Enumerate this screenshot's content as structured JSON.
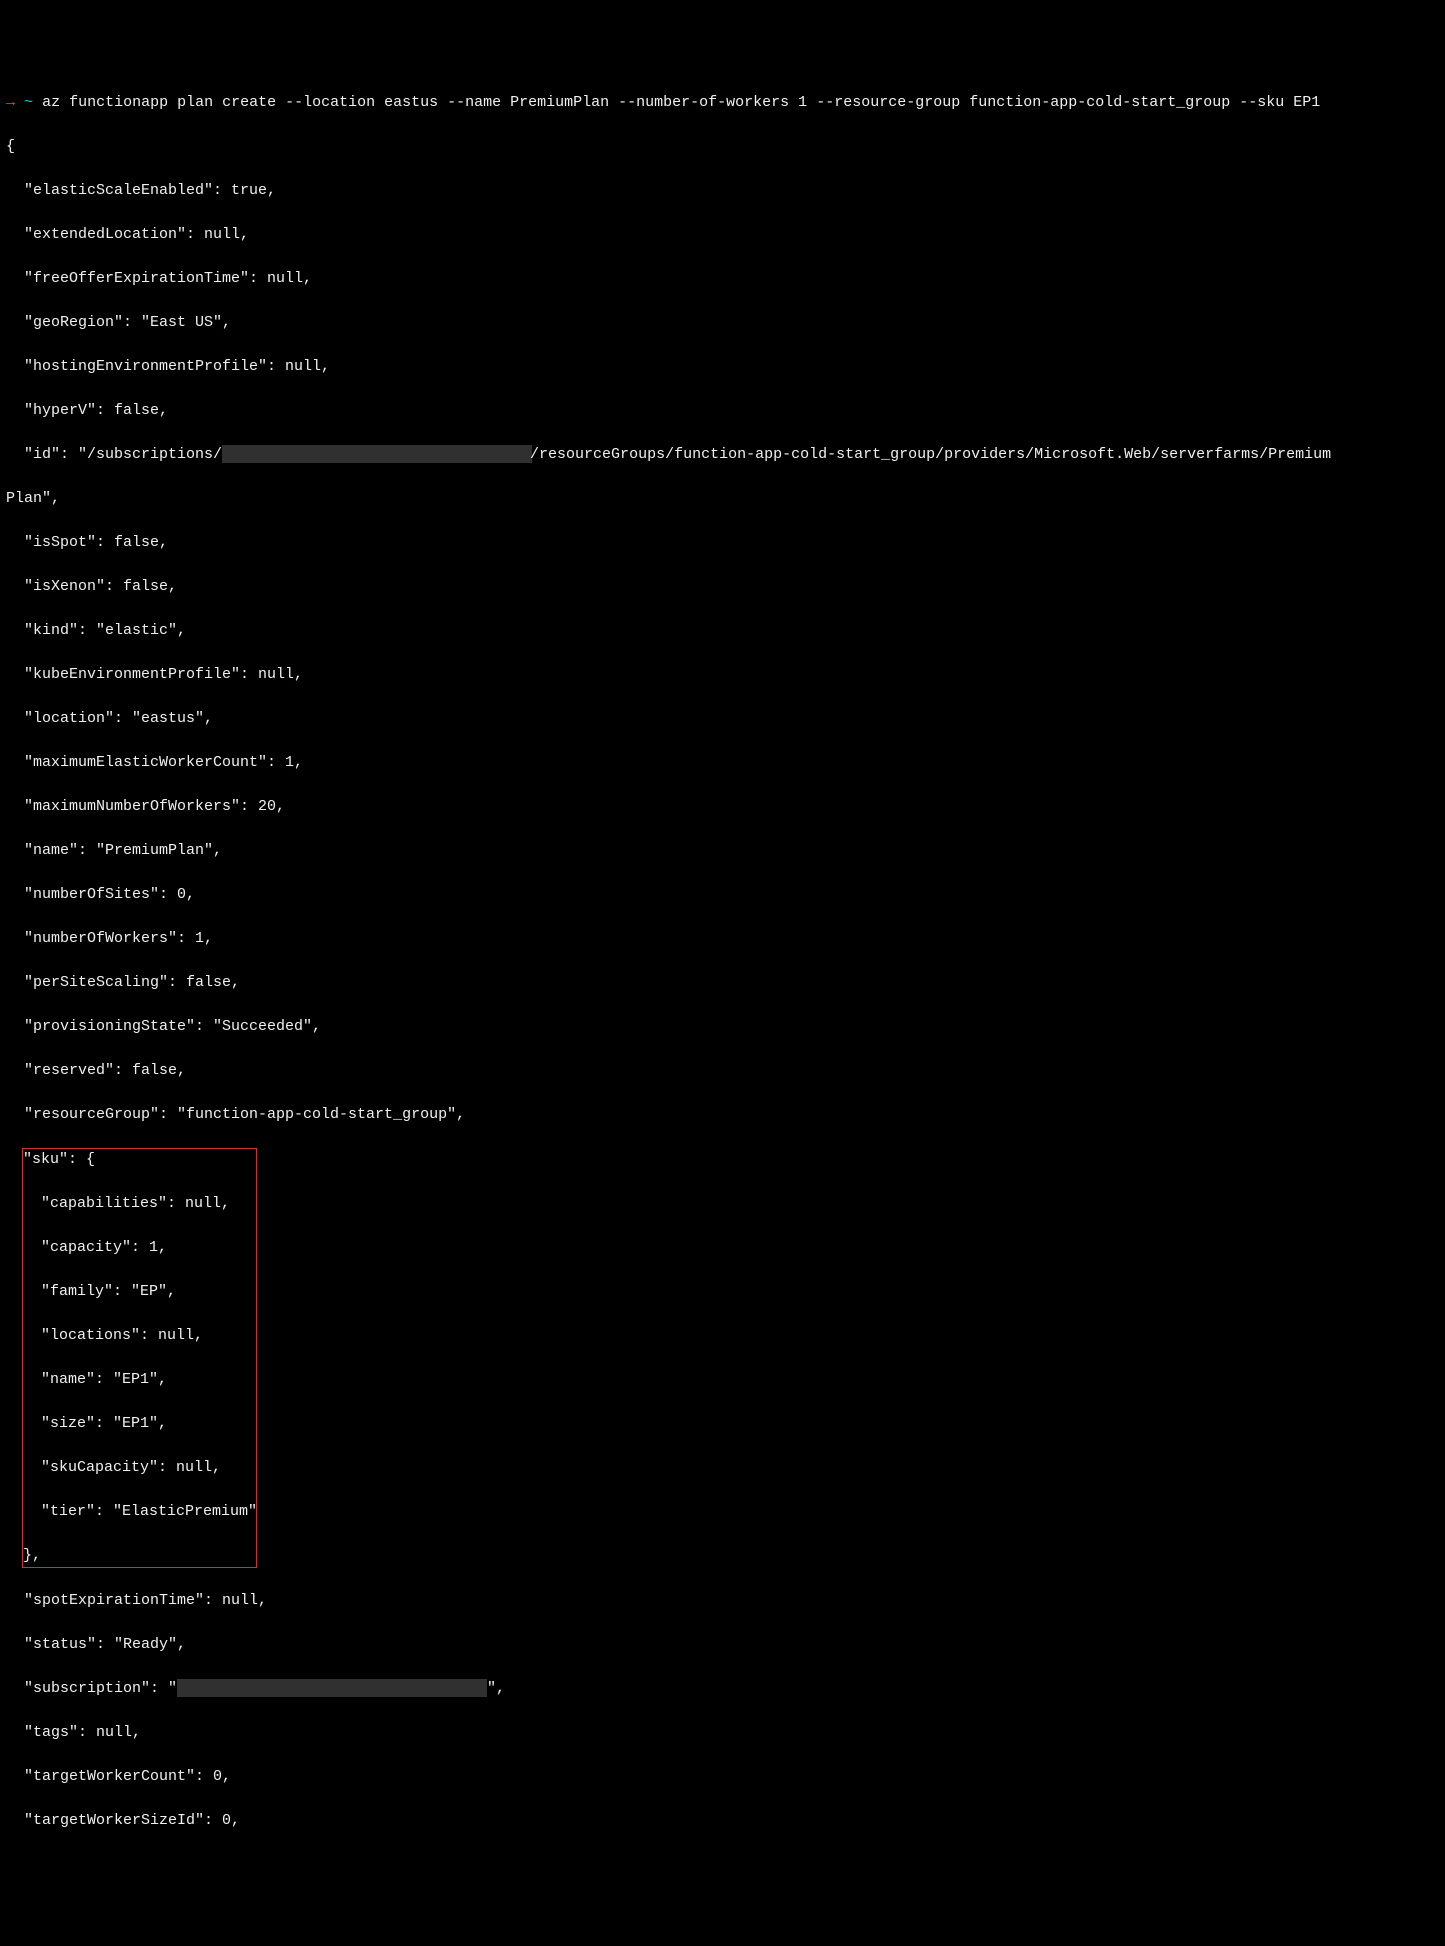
{
  "prompt": {
    "arrow": "→",
    "tilde": "~",
    "command": "az functionapp plan create --location eastus --name PremiumPlan --number-of-workers 1 --resource-group function-app-cold-start_group --sku EP1"
  },
  "json_output": {
    "open_brace": "{",
    "elasticScaleEnabled": "  \"elasticScaleEnabled\": true,",
    "extendedLocation": "  \"extendedLocation\": null,",
    "freeOfferExpirationTime": "  \"freeOfferExpirationTime\": null,",
    "geoRegion": "  \"geoRegion\": \"East US\",",
    "hostingEnvironmentProfile": "  \"hostingEnvironmentProfile\": null,",
    "hyperV": "  \"hyperV\": false,",
    "id_prefix": "  \"id\": \"/subscriptions/",
    "id_suffix": "/resourceGroups/function-app-cold-start_group/providers/Microsoft.Web/serverfarms/Premium",
    "plan_wrap": "Plan\",",
    "isSpot": "  \"isSpot\": false,",
    "isXenon": "  \"isXenon\": false,",
    "kind": "  \"kind\": \"elastic\",",
    "kubeEnvironmentProfile": "  \"kubeEnvironmentProfile\": null,",
    "location": "  \"location\": \"eastus\",",
    "maximumElasticWorkerCount": "  \"maximumElasticWorkerCount\": 1,",
    "maximumNumberOfWorkers": "  \"maximumNumberOfWorkers\": 20,",
    "name": "  \"name\": \"PremiumPlan\",",
    "numberOfSites": "  \"numberOfSites\": 0,",
    "numberOfWorkers": "  \"numberOfWorkers\": 1,",
    "perSiteScaling": "  \"perSiteScaling\": false,",
    "provisioningState": "  \"provisioningState\": \"Succeeded\",",
    "reserved": "  \"reserved\": false,",
    "resourceGroup": "  \"resourceGroup\": \"function-app-cold-start_group\",",
    "sku_open": "\"sku\": {",
    "sku_capabilities": "  \"capabilities\": null,",
    "sku_capacity": "  \"capacity\": 1,",
    "sku_family": "  \"family\": \"EP\",",
    "sku_locations": "  \"locations\": null,",
    "sku_name": "  \"name\": \"EP1\",",
    "sku_size": "  \"size\": \"EP1\",",
    "sku_skuCapacity": "  \"skuCapacity\": null,",
    "sku_tier": "  \"tier\": \"ElasticPremium\"",
    "sku_close": "},",
    "spotExpirationTime": "  \"spotExpirationTime\": null,",
    "status": "  \"status\": \"Ready\",",
    "subscription_prefix": "  \"subscription\": \"",
    "subscription_suffix": "\",",
    "tags": "  \"tags\": null,",
    "targetWorkerCount": "  \"targetWorkerCount\": 0,",
    "targetWorkerSizeId": "  \"targetWorkerSizeId\": 0,"
  }
}
